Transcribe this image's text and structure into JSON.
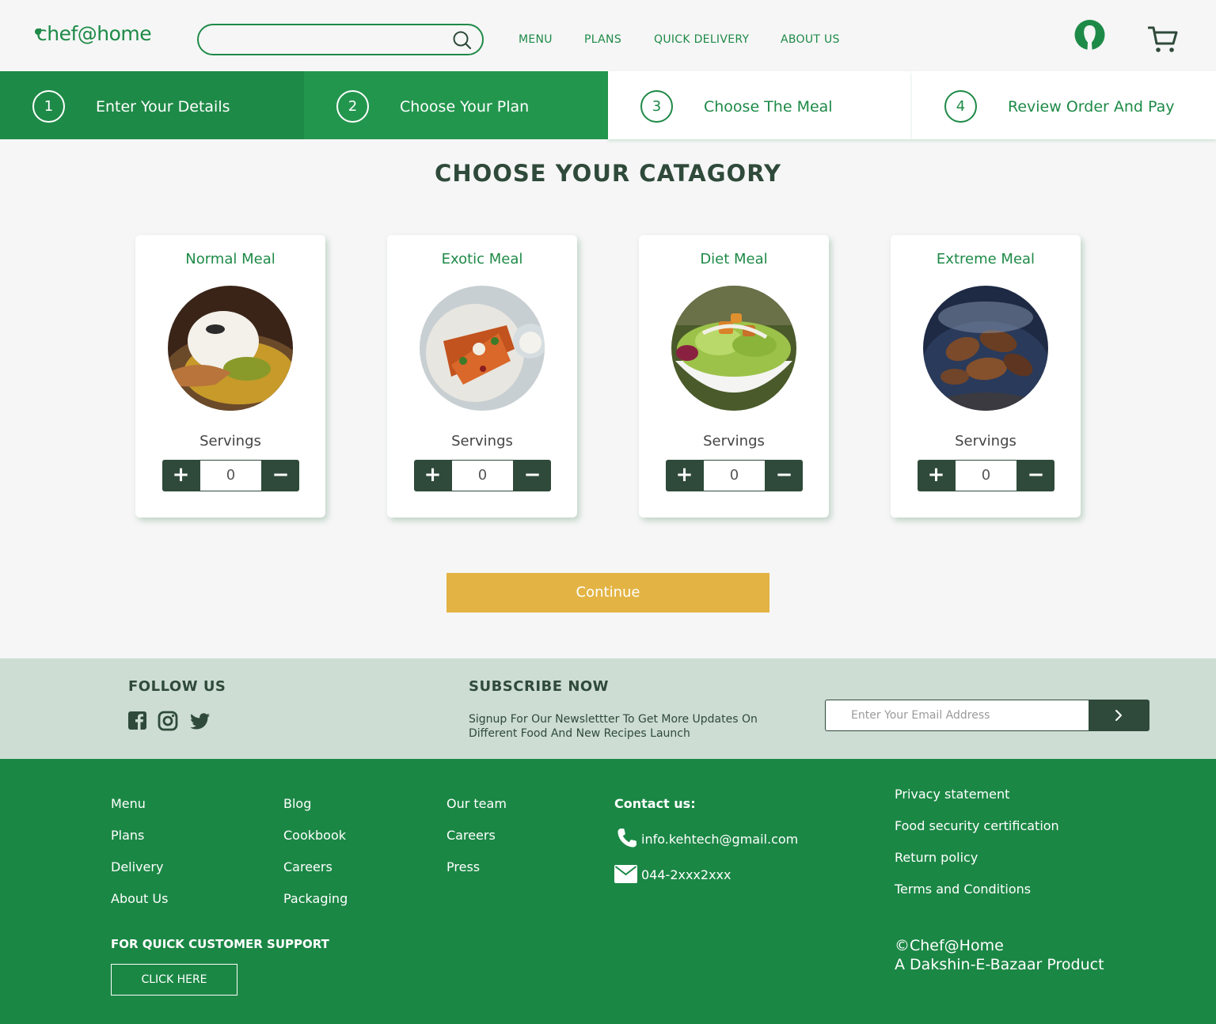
{
  "header": {
    "logo_text": "chef@home",
    "search": {
      "value": "",
      "placeholder": ""
    },
    "nav": [
      "MENU",
      "PLANS",
      "QUICK DELIVERY",
      "ABOUT US"
    ],
    "icons": {
      "search": "search-icon",
      "user": "user-icon",
      "cart": "cart-icon"
    }
  },
  "steps": [
    {
      "number": "1",
      "label": "Enter Your Details",
      "state": "done"
    },
    {
      "number": "2",
      "label": "Choose Your Plan",
      "state": "active"
    },
    {
      "number": "3",
      "label": "Choose The Meal",
      "state": "todo"
    },
    {
      "number": "4",
      "label": "Review Order And Pay",
      "state": "todo"
    }
  ],
  "main": {
    "title": "CHOOSE YOUR CATAGORY",
    "cards": [
      {
        "title": "Normal Meal",
        "servings_label": "Servings",
        "quantity": "0",
        "plus": "+",
        "minus": "−"
      },
      {
        "title": "Exotic Meal",
        "servings_label": "Servings",
        "quantity": "0",
        "plus": "+",
        "minus": "−"
      },
      {
        "title": "Diet Meal",
        "servings_label": "Servings",
        "quantity": "0",
        "plus": "+",
        "minus": "−"
      },
      {
        "title": "Extreme Meal",
        "servings_label": "Servings",
        "quantity": "0",
        "plus": "+",
        "minus": "−"
      }
    ],
    "continue_label": "Continue"
  },
  "band": {
    "follow_title": "FOLLOW US",
    "social": [
      "facebook-icon",
      "instagram-icon",
      "twitter-icon"
    ],
    "subscribe_title": "SUBSCRIBE NOW",
    "subscribe_text": "Signup For Our Newslettter To Get More Updates On Different Food And New Recipes Launch",
    "email_placeholder": "Enter Your Email Address"
  },
  "footer": {
    "col1": [
      "Menu",
      "Plans",
      "Delivery",
      "About Us"
    ],
    "col2": [
      "Blog",
      "Cookbook",
      "Careers",
      "Packaging"
    ],
    "col3": [
      "Our team",
      "Careers",
      "Press"
    ],
    "contact_title": "Contact us:",
    "contact_email": "info.kehtech@gmail.com",
    "contact_phone": "044-2xxx2xxx",
    "col5": [
      "Privacy statement",
      "Food security certification",
      "Return policy",
      "Terms and Conditions"
    ],
    "support_title": "FOR QUICK CUSTOMER SUPPORT",
    "support_button": "CLICK HERE",
    "copyright_line1": "©Chef@Home",
    "copyright_line2": "A Dakshin-E-Bazaar Product"
  },
  "colors": {
    "brand_green": "#1e8a47",
    "dark_green": "#2f4a3a",
    "accent_yellow": "#e3b444",
    "band_bg": "#cdddd3"
  }
}
